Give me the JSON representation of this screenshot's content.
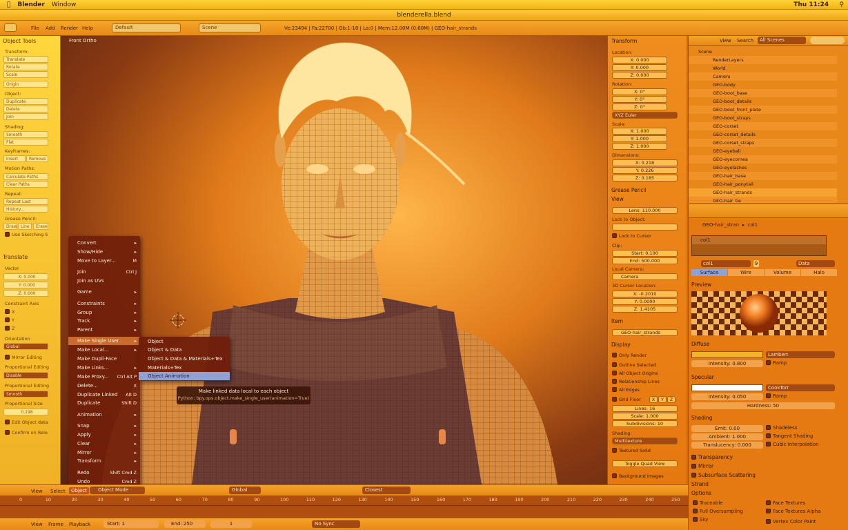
{
  "macbar": {
    "app": "Blender",
    "menu_window": "Window",
    "clock": "Thu 11:24"
  },
  "window_title": "blenderella.blend",
  "header": {
    "menus": [
      "File",
      "Add",
      "Render",
      "Help"
    ],
    "screen_layout": "Default",
    "scene": "Scene",
    "stats": "Ve:23494 | Fa:22700 | Ob:1-18 | La:0 | Mem:12.00M (0.60M) | GEO-hair_strands"
  },
  "toolshelf": {
    "title": "Object Tools",
    "transform_label": "Transform:",
    "translate": "Translate",
    "rotate": "Rotate",
    "scale": "Scale",
    "origin": "Origin",
    "object_label": "Object:",
    "duplicate": "Duplicate",
    "delete": "Delete",
    "join": "Join",
    "shading_label": "Shading:",
    "smooth": "Smooth",
    "flat": "Flat",
    "keyframes_label": "Keyframes:",
    "insert": "Insert",
    "remove": "Remove",
    "motion_paths_label": "Motion Paths:",
    "calculate_paths": "Calculate Paths",
    "clear_paths": "Clear Paths",
    "repeat_label": "Repeat:",
    "repeat_last": "Repeat Last",
    "history": "History...",
    "grease_label": "Grease Pencil:",
    "draw": "Draw",
    "line": "Line",
    "erase": "Erase",
    "use_sketching": "Use Sketching S",
    "op_title": "Translate",
    "vector_label": "Vector",
    "vx": "X: 0.000",
    "vy": "Y: 0.000",
    "vz": "Z: 0.000",
    "constraint_axis": "Constraint Axis",
    "ax_x": "X",
    "ax_y": "Y",
    "ax_z": "Z",
    "orientation_label": "Orientation",
    "orientation": "Global",
    "mirror_editing": "Mirror Editing",
    "prop_editing_label": "Proportional Editing",
    "prop_editing": "Disable",
    "prop_falloff_label": "Proportional Editing",
    "prop_falloff": "Smooth",
    "prop_size_label": "Proportional Size",
    "prop_size": "0.198",
    "edit_object_data": "Edit Object data",
    "confirm_on_release": "Confirm on Rele"
  },
  "viewport": {
    "view_name": "Front Ortho"
  },
  "object_menu": {
    "items": [
      {
        "label": "Convert",
        "sc": "▸"
      },
      {
        "label": "Show/Hide",
        "sc": "▸"
      },
      {
        "label": "Move to Layer...",
        "sc": "M"
      },
      {
        "label": "Join",
        "sc": "Ctrl J"
      },
      {
        "label": "Join as UVs",
        "sc": ""
      },
      {
        "label": "Game",
        "sc": "▸"
      },
      {
        "label": "Constraints",
        "sc": "▸"
      },
      {
        "label": "Group",
        "sc": "▸"
      },
      {
        "label": "Track",
        "sc": "▸"
      },
      {
        "label": "Parent",
        "sc": "▸"
      },
      {
        "label": "Make Single User",
        "sc": "▸"
      },
      {
        "label": "Make Local...",
        "sc": "▸"
      },
      {
        "label": "Make Dupli-Face",
        "sc": ""
      },
      {
        "label": "Make Links...",
        "sc": "▸"
      },
      {
        "label": "Make Proxy...",
        "sc": "Ctrl Alt P"
      },
      {
        "label": "Delete...",
        "sc": "X"
      },
      {
        "label": "Duplicate Linked",
        "sc": "Alt D"
      },
      {
        "label": "Duplicate",
        "sc": "Shift D"
      },
      {
        "label": "Animation",
        "sc": "▸"
      },
      {
        "label": "Snap",
        "sc": "▸"
      },
      {
        "label": "Apply",
        "sc": "▸"
      },
      {
        "label": "Clear",
        "sc": "▸"
      },
      {
        "label": "Mirror",
        "sc": "▸"
      },
      {
        "label": "Transform",
        "sc": "▸"
      },
      {
        "label": "Redo",
        "sc": "Shift Cmd Z"
      },
      {
        "label": "Undo",
        "sc": "Cmd Z"
      }
    ]
  },
  "single_user_menu": {
    "items": [
      "Object",
      "Object & Data",
      "Object & Data & Materials+Tex",
      "Materials+Tex",
      "Object Animation"
    ]
  },
  "tooltip": {
    "text": "Make linked data local to each object",
    "python": "Python: bpy.ops.object.make_single_user(animation=True)"
  },
  "props": {
    "transform": "Transform",
    "location": "Location:",
    "loc": [
      "X: 0.000",
      "Y: 0.000",
      "Z: 0.000"
    ],
    "rotation": "Rotation:",
    "rot": [
      "X: 0°",
      "Y: 0°",
      "Z: 0°"
    ],
    "rot_mode": "XYZ Euler",
    "scale": "Scale:",
    "scl": [
      "X: 1.000",
      "Y: 1.000",
      "Z: 1.000"
    ],
    "dimensions": "Dimensions:",
    "dim": [
      "X: 0.218",
      "Y: 0.226",
      "Z: 0.185"
    ],
    "grease_pencil": "Grease Pencil",
    "view": "View",
    "lens": "Lens: 110.000",
    "lock_to_object": "Lock to Object:",
    "lock_to_cursor": "Lock to Cursor",
    "clip": "Clip:",
    "clip_start": "Start: 0.100",
    "clip_end": "End: 500.000",
    "local_camera": "Local Camera:",
    "camera": "Camera",
    "cursor_location": "3D Cursor Location:",
    "cur": [
      "X: -0.2010",
      "Y: 0.0000",
      "Z: 1.4105"
    ],
    "item": "Item",
    "item_name": "GEO-hair_strands",
    "display": "Display",
    "only_render": "Only Render",
    "outline_selected": "Outline Selected",
    "all_object_origins": "All Object Origins",
    "relationship_lines": "Relationship Lines",
    "all_edges": "All Edges",
    "grid_floor": "Grid Floor",
    "gx": "X",
    "gy": "Y",
    "gz": "Z",
    "lines": "Lines: 16",
    "grid_scale": "Scale: 1.000",
    "subdivisions": "Subdivisions: 10",
    "shading": "Shading:",
    "multitexture": "Multitexture",
    "textured_solid": "Textured Solid",
    "toggle_quad_view": "Toggle Quad View",
    "background_images": "Background Images"
  },
  "outliner": {
    "view": "View",
    "search": "Search",
    "filter": "All Scenes",
    "rows": [
      "Scene",
      "RenderLayers",
      "World",
      "Camera",
      "GEO-body",
      "GEO-boot_base",
      "GEO-boot_details",
      "GEO-boot_front_plate",
      "GEO-boot_straps",
      "GEO-corset",
      "GEO-corset_details",
      "GEO-corset_straps",
      "GEO-eyeball",
      "GEO-eyecornea",
      "GEO-eyelashes",
      "GEO-hair_base",
      "GEO-hair_ponytail",
      "GEO-hair_strands",
      "GEO-hair_tie"
    ]
  },
  "material": {
    "breadcrumb_obj": "GEO-hair_stran",
    "breadcrumb_mat": "col1",
    "slot": "col1",
    "name": "col1",
    "users": "9",
    "link": "Data",
    "tabs": [
      "Surface",
      "Wire",
      "Volume",
      "Halo"
    ],
    "preview": "Preview",
    "diffuse": "Diffuse",
    "diffuse_shader": "Lambert",
    "diffuse_intensity": "Intensity: 0.800",
    "ramp": "Ramp",
    "specular": "Specular",
    "specular_shader": "CookTorr",
    "specular_intensity": "Intensity: 0.050",
    "spec_ramp": "Ramp",
    "hardness": "Hardness: 50",
    "shading": "Shading",
    "emit": "Emit: 0.00",
    "shadeless": "Shadeless",
    "ambient": "Ambient: 1.000",
    "tangent_shading": "Tangent Shading",
    "translucency": "Translucency: 0.000",
    "cubic_interpolation": "Cubic Interpolation",
    "transparency": "Transparency",
    "mirror": "Mirror",
    "sss": "Subsurface Scattering",
    "strand": "Strand",
    "options": "Options",
    "traceable": "Traceable",
    "face_textures": "Face Textures",
    "full_oversampling": "Full Oversampling",
    "face_textures_alpha": "Face Textures Alpha",
    "sky": "Sky",
    "vertex_color_paint": "Vertex Color Paint"
  },
  "vheader": {
    "view": "View",
    "select": "Select",
    "object": "Object",
    "mode": "Object Mode",
    "orientation": "Global",
    "snap": "Closest"
  },
  "timeline": {
    "ticks": [
      "0",
      "10",
      "20",
      "30",
      "40",
      "50",
      "60",
      "70",
      "80",
      "90",
      "100",
      "110",
      "120",
      "130",
      "140",
      "150",
      "160",
      "170",
      "180",
      "190",
      "200",
      "210",
      "220",
      "230",
      "240",
      "250"
    ],
    "view": "View",
    "frame": "Frame",
    "playback": "Playback",
    "start": "Start: 1",
    "end": "End: 250",
    "current": "1",
    "sync": "No Sync"
  },
  "colors": {
    "accent": "#f5a230",
    "menu_bg": "#701e0a",
    "highlight": "#8fa2d6"
  }
}
